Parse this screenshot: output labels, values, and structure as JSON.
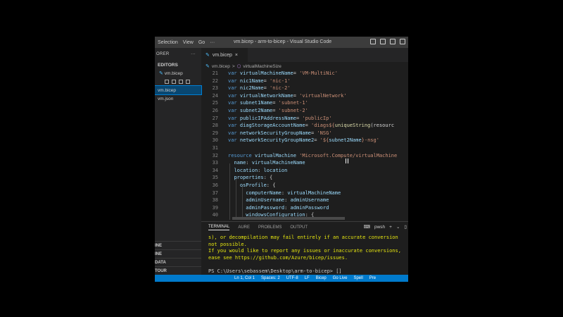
{
  "titlebar": {
    "menu": [
      "Selection",
      "View",
      "Go",
      "···"
    ],
    "title": "vm.bicep - arm-to-bicep - Visual Studio Code"
  },
  "sidebar": {
    "header": "ORER",
    "more": "···",
    "section": "EDITORS",
    "open_file": "vm.bicep",
    "files": [
      "vm.bicep",
      "vm.json"
    ],
    "bottom": [
      "INE",
      "INE",
      "DATA",
      "TOUR"
    ]
  },
  "editor": {
    "tab_label": "vm.bicep",
    "breadcrumb_file": "vm.bicep",
    "breadcrumb_sep": ">",
    "breadcrumb_symbol": "virtualMachineSize",
    "lines": [
      {
        "n": "21",
        "parts": [
          [
            "kw",
            "var "
          ],
          [
            "id",
            "virtualMachineName"
          ],
          [
            "",
            "= "
          ],
          [
            "str",
            "'VM-MultiNic'"
          ]
        ]
      },
      {
        "n": "22",
        "parts": [
          [
            "kw",
            "var "
          ],
          [
            "id",
            "nic1Name"
          ],
          [
            "",
            "= "
          ],
          [
            "str",
            "'nic-1'"
          ]
        ]
      },
      {
        "n": "23",
        "parts": [
          [
            "kw",
            "var "
          ],
          [
            "id",
            "nic2Name"
          ],
          [
            "",
            "= "
          ],
          [
            "str",
            "'nic-2'"
          ]
        ]
      },
      {
        "n": "24",
        "parts": [
          [
            "kw",
            "var "
          ],
          [
            "id",
            "virtualNetworkName"
          ],
          [
            "",
            "= "
          ],
          [
            "str",
            "'virtualNetwork'"
          ]
        ]
      },
      {
        "n": "25",
        "parts": [
          [
            "kw",
            "var "
          ],
          [
            "id",
            "subnet1Name"
          ],
          [
            "",
            "= "
          ],
          [
            "str",
            "'subnet-1'"
          ]
        ]
      },
      {
        "n": "26",
        "parts": [
          [
            "kw",
            "var "
          ],
          [
            "id",
            "subnet2Name"
          ],
          [
            "",
            "= "
          ],
          [
            "str",
            "'subnet-2'"
          ]
        ]
      },
      {
        "n": "27",
        "parts": [
          [
            "kw",
            "var "
          ],
          [
            "id",
            "publicIPAddressName"
          ],
          [
            "",
            "= "
          ],
          [
            "str",
            "'publicIp'"
          ]
        ]
      },
      {
        "n": "28",
        "parts": [
          [
            "kw",
            "var "
          ],
          [
            "id",
            "diagStorageAccountName"
          ],
          [
            "",
            "= "
          ],
          [
            "str",
            "'diags${"
          ],
          [
            "fn",
            "uniqueString"
          ],
          [
            "",
            "(resourc"
          ]
        ]
      },
      {
        "n": "29",
        "parts": [
          [
            "kw",
            "var "
          ],
          [
            "id",
            "networkSecurityGroupName"
          ],
          [
            "",
            "= "
          ],
          [
            "str",
            "'NSG'"
          ]
        ]
      },
      {
        "n": "30",
        "parts": [
          [
            "kw",
            "var "
          ],
          [
            "id",
            "networkSecurityGroupName2"
          ],
          [
            "",
            "= "
          ],
          [
            "str",
            "'${"
          ],
          [
            "id",
            "subnet2Name"
          ],
          [
            "str",
            "}-nsg'"
          ]
        ]
      },
      {
        "n": "31",
        "parts": []
      },
      {
        "n": "32",
        "parts": [
          [
            "kw",
            "resource "
          ],
          [
            "id",
            "virtualMachine "
          ],
          [
            "str",
            "'Microsoft.Compute/virtualMachine"
          ]
        ]
      },
      {
        "n": "33",
        "parts": [
          [
            "",
            "  "
          ],
          [
            "id",
            "name"
          ],
          [
            "",
            ": "
          ],
          [
            "id",
            "virtualMachineName"
          ]
        ]
      },
      {
        "n": "34",
        "parts": [
          [
            "",
            "  "
          ],
          [
            "id",
            "location"
          ],
          [
            "",
            ": "
          ],
          [
            "id",
            "location"
          ]
        ]
      },
      {
        "n": "35",
        "parts": [
          [
            "",
            "  "
          ],
          [
            "id",
            "properties"
          ],
          [
            "",
            ": {"
          ]
        ]
      },
      {
        "n": "36",
        "parts": [
          [
            "",
            "    "
          ],
          [
            "id",
            "osProfile"
          ],
          [
            "",
            ": {"
          ]
        ]
      },
      {
        "n": "37",
        "parts": [
          [
            "",
            "      "
          ],
          [
            "id",
            "computerName"
          ],
          [
            "",
            ": "
          ],
          [
            "id",
            "virtualMachineName"
          ]
        ]
      },
      {
        "n": "38",
        "parts": [
          [
            "",
            "      "
          ],
          [
            "id",
            "adminUsername"
          ],
          [
            "",
            ": "
          ],
          [
            "id",
            "adminUsername"
          ]
        ]
      },
      {
        "n": "39",
        "parts": [
          [
            "",
            "      "
          ],
          [
            "id",
            "adminPassword"
          ],
          [
            "",
            ": "
          ],
          [
            "id",
            "adminPassword"
          ]
        ]
      },
      {
        "n": "40",
        "parts": [
          [
            "",
            "      "
          ],
          [
            "id",
            "windowsConfiguration"
          ],
          [
            "",
            ": {"
          ]
        ]
      }
    ]
  },
  "panel": {
    "tabs": [
      "TERMINAL",
      "AURE",
      "PROBLEMS",
      "OUTPUT"
    ],
    "shell": "pwsh",
    "actions": [
      "+",
      "⌄",
      "▯",
      "🗑"
    ],
    "lines": [
      "s), or decompilation may fail entirely if an accurate conversion",
      "not possible.",
      "If you would like to report any issues or inaccurate conversions,",
      "ease see https://github.com/Azure/bicep/issues."
    ],
    "prompt": "PS C:\\Users\\sebassem\\Desktop\\arm-to-bicep> []"
  },
  "statusbar": {
    "items": [
      "Ln 1, Col 1",
      "Spaces: 2",
      "UTF-8",
      "LF",
      "Bicep",
      "Go Live",
      "Spell",
      "Pre"
    ]
  },
  "colors": {
    "status_bg": "#007acc",
    "editor_bg": "#1e1e1e",
    "keyword": "#569cd6",
    "string": "#ce9178",
    "terminal_warning": "#e5e510"
  }
}
